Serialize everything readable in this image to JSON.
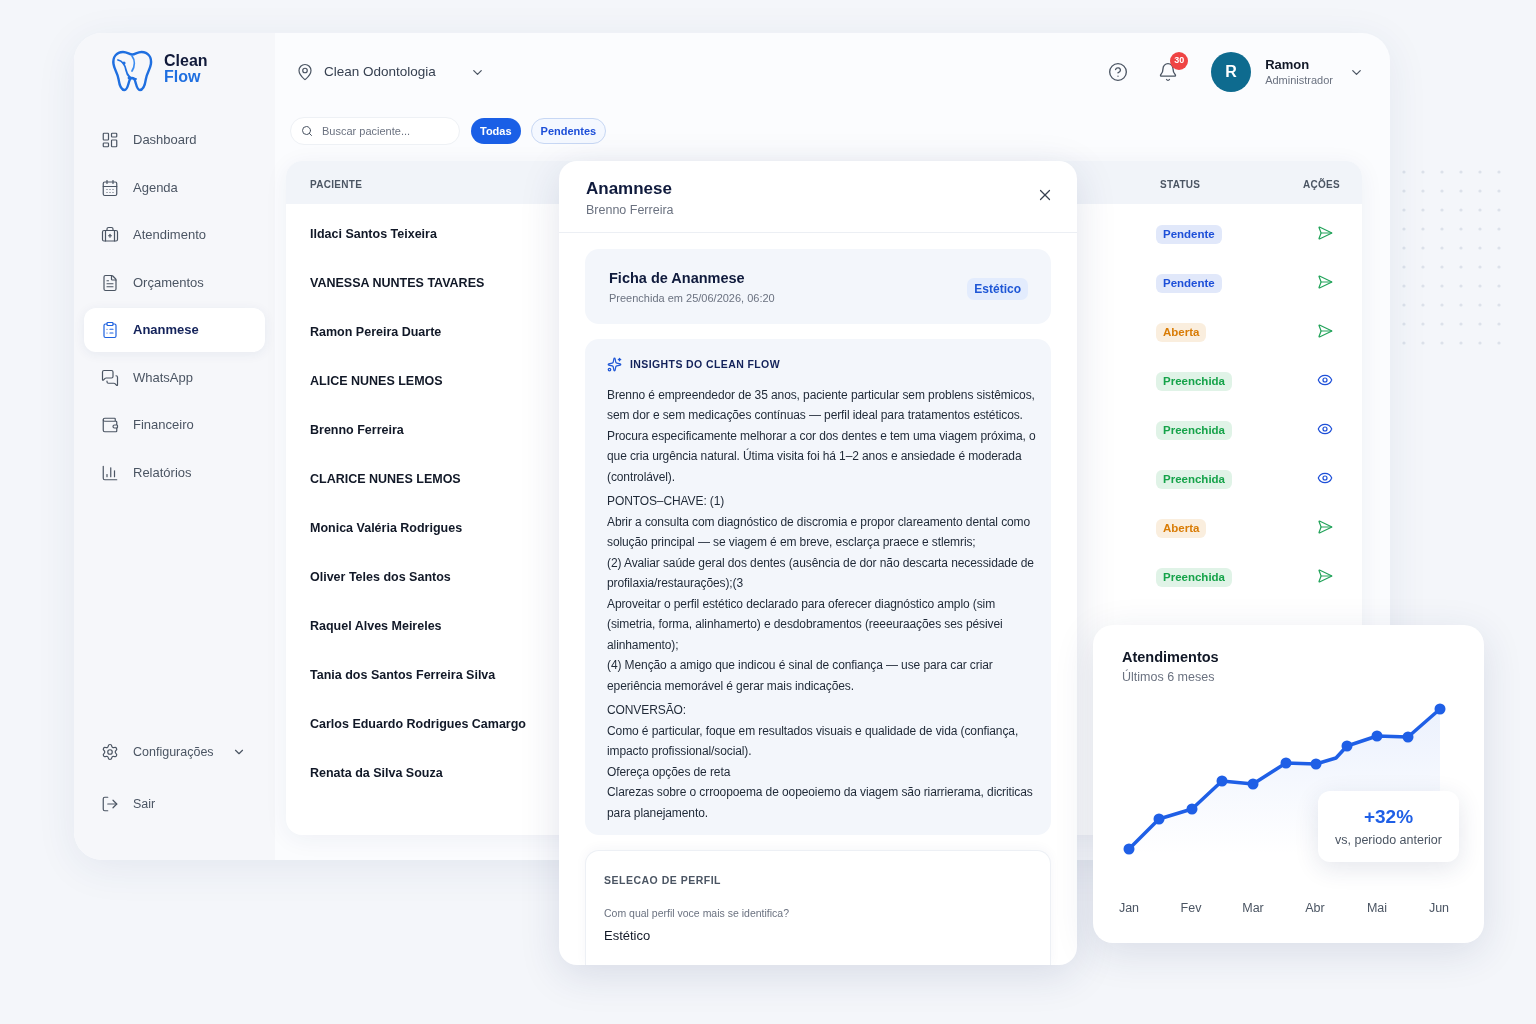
{
  "sidebar": {
    "logo": {
      "line_1": "Clean",
      "line_2": "Flow"
    },
    "items": [
      {
        "label": "Dashboard",
        "selected": false
      },
      {
        "label": "Agenda",
        "selected": false
      },
      {
        "label": "Atendimento",
        "selected": false
      },
      {
        "label": "Orçamentos",
        "selected": false
      },
      {
        "label": "Ananmese",
        "selected": true
      },
      {
        "label": "WhatsApp",
        "selected": false
      },
      {
        "label": "Financeiro",
        "selected": false
      },
      {
        "label": "Relatórios",
        "selected": false
      }
    ],
    "footer_items": [
      {
        "label": "Configurações",
        "expanded": false
      },
      {
        "label": "Sair"
      }
    ]
  },
  "header": {
    "location": "Clean Odontologia",
    "notifications": "30",
    "user": {
      "initial": "R",
      "name": "Ramon",
      "role": "Administrador"
    }
  },
  "filters": {
    "search": {
      "placeholder": "Buscar paciente..."
    },
    "chips": [
      {
        "label": "Todas",
        "selected": true
      },
      {
        "label": "Pendentes",
        "selected": false
      }
    ]
  },
  "table": {
    "columns": [
      "PACIENTE",
      "STATUS",
      "AÇÕES"
    ],
    "rows": [
      {
        "name": "Ildaci Santos Teixeira",
        "status": {
          "label": "Pendente",
          "color": "#1d4fd8"
        },
        "action": {
          "kind": "send"
        }
      },
      {
        "name": "VANESSA NUNTES TAVARES",
        "status": {
          "label": "Pendente",
          "color": "#1d4fd8"
        },
        "action": {
          "kind": "send"
        }
      },
      {
        "name": "Ramon Pereira Duarte",
        "status": {
          "label": "Aberta",
          "color": "#d97c06"
        },
        "action": {
          "kind": "send"
        }
      },
      {
        "name": "ALICE NUNES LEMOS",
        "status": {
          "label": "Preenchida",
          "color": "#16a34a"
        },
        "action": {
          "kind": "view"
        }
      },
      {
        "name": "Brenno Ferreira",
        "status": {
          "label": "Preenchida",
          "color": "#16a34a"
        },
        "action": {
          "kind": "view"
        }
      },
      {
        "name": "CLARICE NUNES LEMOS",
        "status": {
          "label": "Preenchida",
          "color": "#16a34a"
        },
        "action": {
          "kind": "view"
        }
      },
      {
        "name": "Monica Valéria Rodrigues",
        "status": {
          "label": "Aberta",
          "color": "#d97c06"
        },
        "action": {
          "kind": "send"
        }
      },
      {
        "name": "Oliver Teles dos Santos",
        "status": {
          "label": "Preenchida",
          "color": "#16a34a"
        },
        "action": {
          "kind": "send"
        }
      },
      {
        "name": "Raquel Alves Meireles"
      },
      {
        "name": "Tania dos Santos Ferreira Silva"
      },
      {
        "name": "Carlos Eduardo Rodrigues Camargo"
      },
      {
        "name": "Renata da Silva Souza"
      }
    ]
  },
  "modal": {
    "title": "Anamnese",
    "subtitle": "Brenno Ferreira",
    "form_card": {
      "title": "Ficha de Ananmese",
      "filled_at": "Preenchida em 25/06/2026, 06:20",
      "tag": "Estético"
    },
    "insights": {
      "title": "INSIGHTS DO CLEAN FLOW",
      "paragraphs": [
        {
          "kind": "text",
          "text": "Brenno é empreendedor de 35 anos, paciente particular sem problens sistêmicos, sem dor e sem medicações contínuas — perfil ideal para tratamentos estéticos. Procura especificamente melhorar a cor dos dentes e tem uma viagem próxima, o que cria urgência natural. Útima visita foi há 1–2 anos e ansiedade é moderada (controlável)."
        },
        {
          "kind": "heading",
          "text": "PONTOS–CHAVE: (1)"
        },
        {
          "kind": "text",
          "text": "Abrir a consulta com diagnóstico de discromia e propor clareamento dental como solução principal — se viagem é em breve, esclarça praece e stlemris;"
        },
        {
          "kind": "text",
          "text": "(2) Avaliar saúde geral dos dentes (ausência de dor não descarta necessidade de profilaxia/restaurações);(3"
        },
        {
          "kind": "text",
          "text": "Aproveitar o perfil estético declarado para oferecer diagnóstico amplo (sim (simetria, forma, alinhamerto) e desdobramentos (reeeuraações ses pésivei alinhamento);"
        },
        {
          "kind": "text",
          "text": "(4) Menção a amigo que indicou é sinal de confiança — use para car criar eperiência memorável é gerar mais indicações."
        },
        {
          "kind": "heading",
          "text": "CONVERSÃO:"
        },
        {
          "kind": "text",
          "text": "Como é particular, foque em resultados visuais e qualidade de vida (confiança, impacto profissional/social)."
        },
        {
          "kind": "text",
          "text": "Ofereça opções de reta"
        },
        {
          "kind": "text",
          "text": "Clarezas sobre o crroopoema de oopeoiemo da viagem são riarrierama, dicriticas para planejamento."
        }
      ]
    },
    "profile_section": {
      "title": "SELECAO DE PERFIL",
      "question": "Com qual perfil voce mais se identifica?",
      "answer": "Estético"
    }
  },
  "chart_card": {
    "title": "Atendimentos",
    "subtitle": "Últimos 6 meses",
    "x_labels": [
      "Jan",
      "Fev",
      "Mar",
      "Abr",
      "Mai",
      "Jun"
    ],
    "highlight": {
      "value": "+32%",
      "caption": "vs, periodo anterior"
    }
  }
}
